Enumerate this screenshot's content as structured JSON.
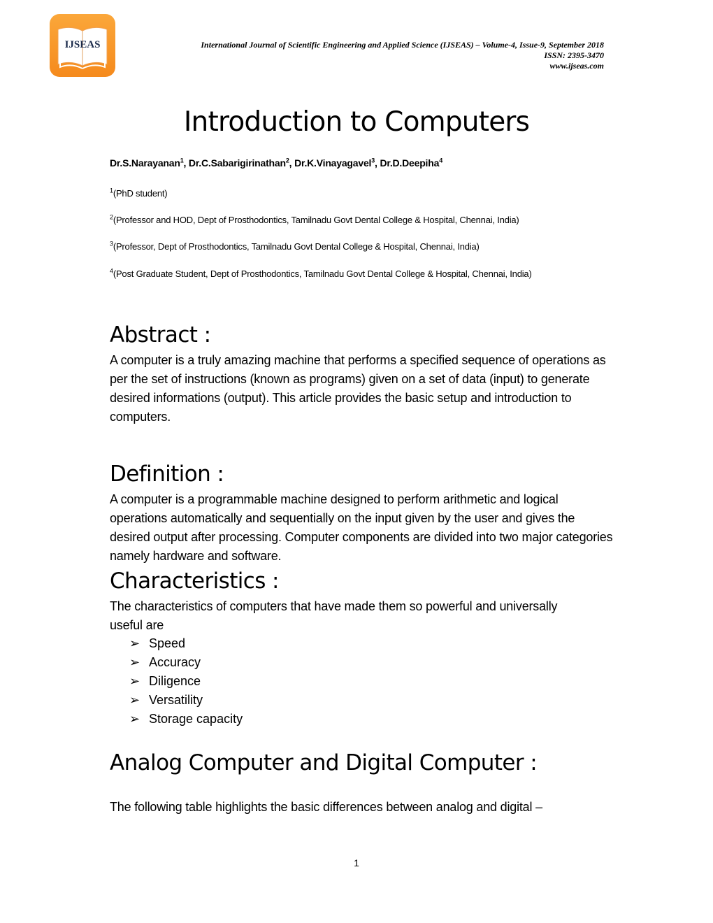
{
  "header": {
    "logo_text": "IJSEAS",
    "journal_line": "International Journal of Scientific Engineering and Applied Science (IJSEAS) – Volume-4, Issue-9, September 2018",
    "issn": "ISSN: 2395-3470",
    "website": "www.ijseas.com"
  },
  "title": "Introduction to Computers",
  "authors": [
    {
      "name": "Dr.S.Narayanan",
      "sup": "1",
      "sep": ", "
    },
    {
      "name": "Dr.C.Sabarigirinathan",
      "sup": "2",
      "sep": ", "
    },
    {
      "name": "Dr.K.Vinayagavel",
      "sup": "3",
      "sep": ", "
    },
    {
      "name": "Dr.D.Deepiha",
      "sup": "4",
      "sep": ""
    }
  ],
  "affiliations": [
    {
      "sup": "1",
      "text": "(PhD student)"
    },
    {
      "sup": "2",
      "text": "(Professor and HOD, Dept of Prosthodontics, Tamilnadu Govt Dental College & Hospital, Chennai, India)"
    },
    {
      "sup": "3",
      "text": "(Professor, Dept of Prosthodontics, Tamilnadu Govt Dental College & Hospital, Chennai, India)"
    },
    {
      "sup": "4",
      "text": "(Post Graduate Student, Dept of Prosthodontics, Tamilnadu Govt Dental College & Hospital, Chennai, India)"
    }
  ],
  "sections": {
    "abstract": {
      "heading": "Abstract :",
      "body": "A computer is a truly amazing machine that performs a specified sequence of operations as per the set of instructions (known as programs) given on a set of data (input) to generate desired informations (output). This article provides the basic setup and introduction to computers."
    },
    "definition": {
      "heading": "Definition :",
      "body": "A computer is a programmable machine designed to perform arithmetic and logical operations automatically and sequentially on the input given by the user and gives the desired output after processing. Computer components are divided into two major categories namely hardware and software."
    },
    "characteristics": {
      "heading": "Characteristics :",
      "body": "The characteristics of computers that have made them so powerful and universally useful are",
      "items": [
        "Speed",
        "Accuracy",
        "Diligence",
        "Versatility",
        "Storage capacity"
      ]
    },
    "analog_digital": {
      "heading": "Analog Computer and Digital Computer :",
      "body": "The following table highlights the basic differences between analog and digital –"
    }
  },
  "page_number": "1"
}
